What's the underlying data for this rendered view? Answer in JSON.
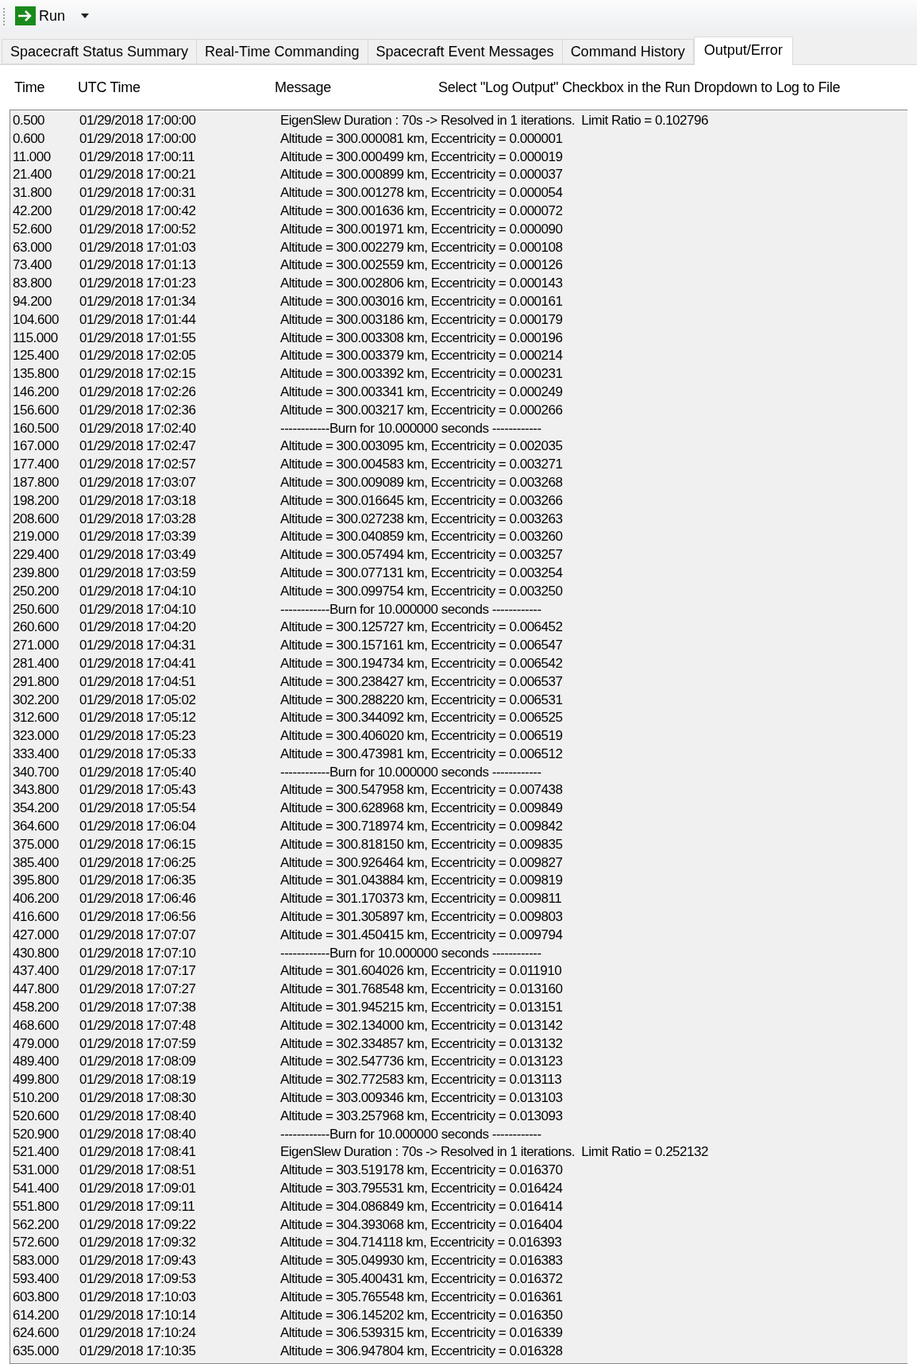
{
  "toolbar": {
    "run_label": "Run"
  },
  "tabs": [
    {
      "label": "Spacecraft Status Summary",
      "selected": false
    },
    {
      "label": "Real-Time Commanding",
      "selected": false
    },
    {
      "label": "Spacecraft Event Messages",
      "selected": false
    },
    {
      "label": "Command History",
      "selected": false
    },
    {
      "label": "Output/Error",
      "selected": true
    }
  ],
  "header": {
    "columns": [
      "Time",
      "UTC Time",
      "Message"
    ],
    "hint": "Select \"Log Output\" Checkbox in the Run Dropdown to Log to File"
  },
  "rows": [
    {
      "time": "0.500",
      "utc_time": "01/29/2018 17:00:00",
      "message": "EigenSlew Duration : 70s -> Resolved in 1 iterations.  Limit Ratio = 0.102796"
    },
    {
      "time": "0.600",
      "utc_time": "01/29/2018 17:00:00",
      "message": "Altitude = 300.000081 km, Eccentricity = 0.000001"
    },
    {
      "time": "11.000",
      "utc_time": "01/29/2018 17:00:11",
      "message": "Altitude = 300.000499 km, Eccentricity = 0.000019"
    },
    {
      "time": "21.400",
      "utc_time": "01/29/2018 17:00:21",
      "message": "Altitude = 300.000899 km, Eccentricity = 0.000037"
    },
    {
      "time": "31.800",
      "utc_time": "01/29/2018 17:00:31",
      "message": "Altitude = 300.001278 km, Eccentricity = 0.000054"
    },
    {
      "time": "42.200",
      "utc_time": "01/29/2018 17:00:42",
      "message": "Altitude = 300.001636 km, Eccentricity = 0.000072"
    },
    {
      "time": "52.600",
      "utc_time": "01/29/2018 17:00:52",
      "message": "Altitude = 300.001971 km, Eccentricity = 0.000090"
    },
    {
      "time": "63.000",
      "utc_time": "01/29/2018 17:01:03",
      "message": "Altitude = 300.002279 km, Eccentricity = 0.000108"
    },
    {
      "time": "73.400",
      "utc_time": "01/29/2018 17:01:13",
      "message": "Altitude = 300.002559 km, Eccentricity = 0.000126"
    },
    {
      "time": "83.800",
      "utc_time": "01/29/2018 17:01:23",
      "message": "Altitude = 300.002806 km, Eccentricity = 0.000143"
    },
    {
      "time": "94.200",
      "utc_time": "01/29/2018 17:01:34",
      "message": "Altitude = 300.003016 km, Eccentricity = 0.000161"
    },
    {
      "time": "104.600",
      "utc_time": "01/29/2018 17:01:44",
      "message": "Altitude = 300.003186 km, Eccentricity = 0.000179"
    },
    {
      "time": "115.000",
      "utc_time": "01/29/2018 17:01:55",
      "message": "Altitude = 300.003308 km, Eccentricity = 0.000196"
    },
    {
      "time": "125.400",
      "utc_time": "01/29/2018 17:02:05",
      "message": "Altitude = 300.003379 km, Eccentricity = 0.000214"
    },
    {
      "time": "135.800",
      "utc_time": "01/29/2018 17:02:15",
      "message": "Altitude = 300.003392 km, Eccentricity = 0.000231"
    },
    {
      "time": "146.200",
      "utc_time": "01/29/2018 17:02:26",
      "message": "Altitude = 300.003341 km, Eccentricity = 0.000249"
    },
    {
      "time": "156.600",
      "utc_time": "01/29/2018 17:02:36",
      "message": "Altitude = 300.003217 km, Eccentricity = 0.000266"
    },
    {
      "time": "160.500",
      "utc_time": "01/29/2018 17:02:40",
      "message": "------------Burn for 10.000000 seconds ------------"
    },
    {
      "time": "167.000",
      "utc_time": "01/29/2018 17:02:47",
      "message": "Altitude = 300.003095 km, Eccentricity = 0.002035"
    },
    {
      "time": "177.400",
      "utc_time": "01/29/2018 17:02:57",
      "message": "Altitude = 300.004583 km, Eccentricity = 0.003271"
    },
    {
      "time": "187.800",
      "utc_time": "01/29/2018 17:03:07",
      "message": "Altitude = 300.009089 km, Eccentricity = 0.003268"
    },
    {
      "time": "198.200",
      "utc_time": "01/29/2018 17:03:18",
      "message": "Altitude = 300.016645 km, Eccentricity = 0.003266"
    },
    {
      "time": "208.600",
      "utc_time": "01/29/2018 17:03:28",
      "message": "Altitude = 300.027238 km, Eccentricity = 0.003263"
    },
    {
      "time": "219.000",
      "utc_time": "01/29/2018 17:03:39",
      "message": "Altitude = 300.040859 km, Eccentricity = 0.003260"
    },
    {
      "time": "229.400",
      "utc_time": "01/29/2018 17:03:49",
      "message": "Altitude = 300.057494 km, Eccentricity = 0.003257"
    },
    {
      "time": "239.800",
      "utc_time": "01/29/2018 17:03:59",
      "message": "Altitude = 300.077131 km, Eccentricity = 0.003254"
    },
    {
      "time": "250.200",
      "utc_time": "01/29/2018 17:04:10",
      "message": "Altitude = 300.099754 km, Eccentricity = 0.003250"
    },
    {
      "time": "250.600",
      "utc_time": "01/29/2018 17:04:10",
      "message": "------------Burn for 10.000000 seconds ------------"
    },
    {
      "time": "260.600",
      "utc_time": "01/29/2018 17:04:20",
      "message": "Altitude = 300.125727 km, Eccentricity = 0.006452"
    },
    {
      "time": "271.000",
      "utc_time": "01/29/2018 17:04:31",
      "message": "Altitude = 300.157161 km, Eccentricity = 0.006547"
    },
    {
      "time": "281.400",
      "utc_time": "01/29/2018 17:04:41",
      "message": "Altitude = 300.194734 km, Eccentricity = 0.006542"
    },
    {
      "time": "291.800",
      "utc_time": "01/29/2018 17:04:51",
      "message": "Altitude = 300.238427 km, Eccentricity = 0.006537"
    },
    {
      "time": "302.200",
      "utc_time": "01/29/2018 17:05:02",
      "message": "Altitude = 300.288220 km, Eccentricity = 0.006531"
    },
    {
      "time": "312.600",
      "utc_time": "01/29/2018 17:05:12",
      "message": "Altitude = 300.344092 km, Eccentricity = 0.006525"
    },
    {
      "time": "323.000",
      "utc_time": "01/29/2018 17:05:23",
      "message": "Altitude = 300.406020 km, Eccentricity = 0.006519"
    },
    {
      "time": "333.400",
      "utc_time": "01/29/2018 17:05:33",
      "message": "Altitude = 300.473981 km, Eccentricity = 0.006512"
    },
    {
      "time": "340.700",
      "utc_time": "01/29/2018 17:05:40",
      "message": "------------Burn for 10.000000 seconds ------------"
    },
    {
      "time": "343.800",
      "utc_time": "01/29/2018 17:05:43",
      "message": "Altitude = 300.547958 km, Eccentricity = 0.007438"
    },
    {
      "time": "354.200",
      "utc_time": "01/29/2018 17:05:54",
      "message": "Altitude = 300.628968 km, Eccentricity = 0.009849"
    },
    {
      "time": "364.600",
      "utc_time": "01/29/2018 17:06:04",
      "message": "Altitude = 300.718974 km, Eccentricity = 0.009842"
    },
    {
      "time": "375.000",
      "utc_time": "01/29/2018 17:06:15",
      "message": "Altitude = 300.818150 km, Eccentricity = 0.009835"
    },
    {
      "time": "385.400",
      "utc_time": "01/29/2018 17:06:25",
      "message": "Altitude = 300.926464 km, Eccentricity = 0.009827"
    },
    {
      "time": "395.800",
      "utc_time": "01/29/2018 17:06:35",
      "message": "Altitude = 301.043884 km, Eccentricity = 0.009819"
    },
    {
      "time": "406.200",
      "utc_time": "01/29/2018 17:06:46",
      "message": "Altitude = 301.170373 km, Eccentricity = 0.009811"
    },
    {
      "time": "416.600",
      "utc_time": "01/29/2018 17:06:56",
      "message": "Altitude = 301.305897 km, Eccentricity = 0.009803"
    },
    {
      "time": "427.000",
      "utc_time": "01/29/2018 17:07:07",
      "message": "Altitude = 301.450415 km, Eccentricity = 0.009794"
    },
    {
      "time": "430.800",
      "utc_time": "01/29/2018 17:07:10",
      "message": "------------Burn for 10.000000 seconds ------------"
    },
    {
      "time": "437.400",
      "utc_time": "01/29/2018 17:07:17",
      "message": "Altitude = 301.604026 km, Eccentricity = 0.011910"
    },
    {
      "time": "447.800",
      "utc_time": "01/29/2018 17:07:27",
      "message": "Altitude = 301.768548 km, Eccentricity = 0.013160"
    },
    {
      "time": "458.200",
      "utc_time": "01/29/2018 17:07:38",
      "message": "Altitude = 301.945215 km, Eccentricity = 0.013151"
    },
    {
      "time": "468.600",
      "utc_time": "01/29/2018 17:07:48",
      "message": "Altitude = 302.134000 km, Eccentricity = 0.013142"
    },
    {
      "time": "479.000",
      "utc_time": "01/29/2018 17:07:59",
      "message": "Altitude = 302.334857 km, Eccentricity = 0.013132"
    },
    {
      "time": "489.400",
      "utc_time": "01/29/2018 17:08:09",
      "message": "Altitude = 302.547736 km, Eccentricity = 0.013123"
    },
    {
      "time": "499.800",
      "utc_time": "01/29/2018 17:08:19",
      "message": "Altitude = 302.772583 km, Eccentricity = 0.013113"
    },
    {
      "time": "510.200",
      "utc_time": "01/29/2018 17:08:30",
      "message": "Altitude = 303.009346 km, Eccentricity = 0.013103"
    },
    {
      "time": "520.600",
      "utc_time": "01/29/2018 17:08:40",
      "message": "Altitude = 303.257968 km, Eccentricity = 0.013093"
    },
    {
      "time": "520.900",
      "utc_time": "01/29/2018 17:08:40",
      "message": "------------Burn for 10.000000 seconds ------------"
    },
    {
      "time": "521.400",
      "utc_time": "01/29/2018 17:08:41",
      "message": "EigenSlew Duration : 70s -> Resolved in 1 iterations.  Limit Ratio = 0.252132"
    },
    {
      "time": "531.000",
      "utc_time": "01/29/2018 17:08:51",
      "message": "Altitude = 303.519178 km, Eccentricity = 0.016370"
    },
    {
      "time": "541.400",
      "utc_time": "01/29/2018 17:09:01",
      "message": "Altitude = 303.795531 km, Eccentricity = 0.016424"
    },
    {
      "time": "551.800",
      "utc_time": "01/29/2018 17:09:11",
      "message": "Altitude = 304.086849 km, Eccentricity = 0.016414"
    },
    {
      "time": "562.200",
      "utc_time": "01/29/2018 17:09:22",
      "message": "Altitude = 304.393068 km, Eccentricity = 0.016404"
    },
    {
      "time": "572.600",
      "utc_time": "01/29/2018 17:09:32",
      "message": "Altitude = 304.714118 km, Eccentricity = 0.016393"
    },
    {
      "time": "583.000",
      "utc_time": "01/29/2018 17:09:43",
      "message": "Altitude = 305.049930 km, Eccentricity = 0.016383"
    },
    {
      "time": "593.400",
      "utc_time": "01/29/2018 17:09:53",
      "message": "Altitude = 305.400431 km, Eccentricity = 0.016372"
    },
    {
      "time": "603.800",
      "utc_time": "01/29/2018 17:10:03",
      "message": "Altitude = 305.765548 km, Eccentricity = 0.016361"
    },
    {
      "time": "614.200",
      "utc_time": "01/29/2018 17:10:14",
      "message": "Altitude = 306.145202 km, Eccentricity = 0.016350"
    },
    {
      "time": "624.600",
      "utc_time": "01/29/2018 17:10:24",
      "message": "Altitude = 306.539315 km, Eccentricity = 0.016339"
    },
    {
      "time": "635.000",
      "utc_time": "01/29/2018 17:10:35",
      "message": "Altitude = 306.947804 km, Eccentricity = 0.016328"
    }
  ]
}
